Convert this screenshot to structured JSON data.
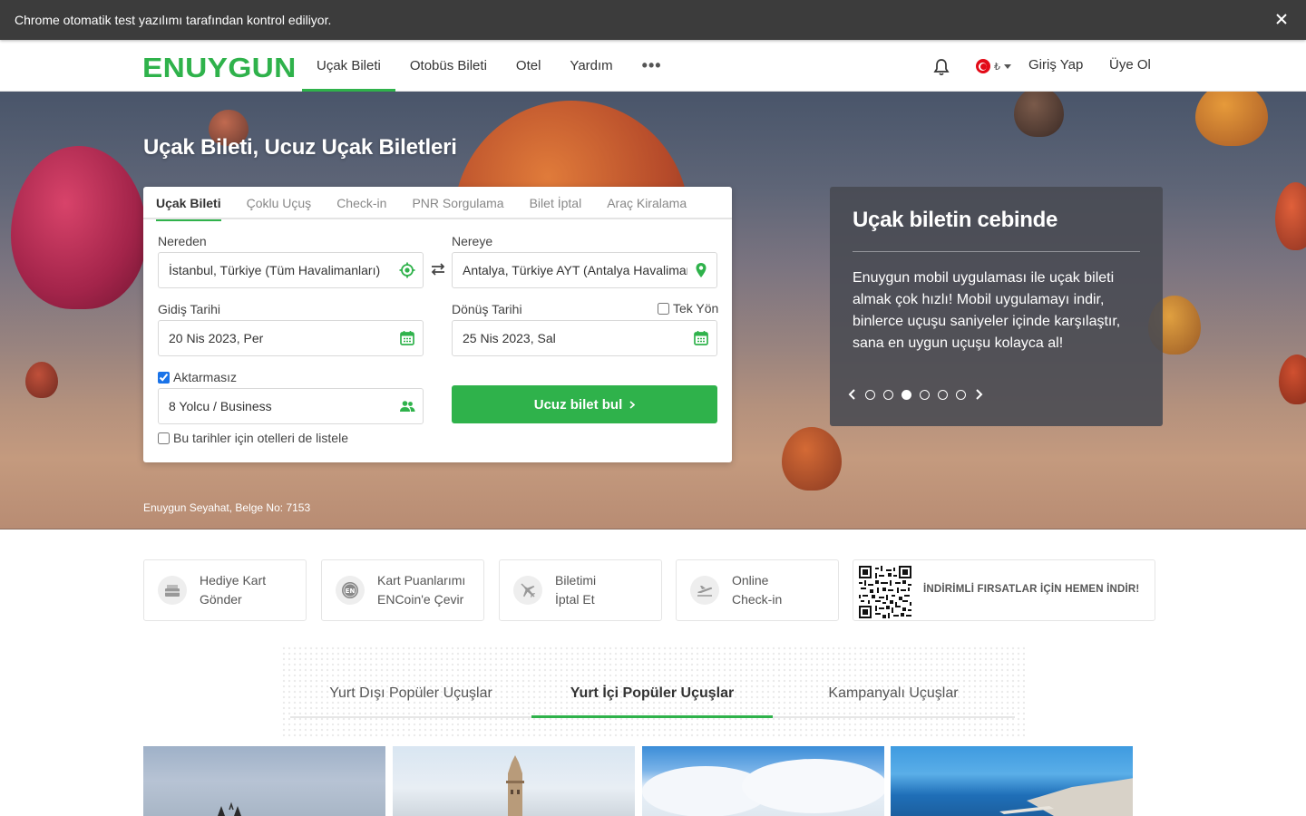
{
  "infobar": {
    "text": "Chrome otomatik test yazılımı tarafından kontrol ediliyor."
  },
  "header": {
    "logo": "ENUYGUN",
    "nav": [
      "Uçak Bileti",
      "Otobüs Bileti",
      "Otel",
      "Yardım"
    ],
    "more": "•••",
    "currency": "₺",
    "login": "Giriş Yap",
    "register": "Üye Ol"
  },
  "hero": {
    "title": "Uçak Bileti, Ucuz Uçak Biletleri",
    "belge": "Enuygun Seyahat, Belge No: 7153"
  },
  "search": {
    "tabs": [
      "Uçak Bileti",
      "Çoklu Uçuş",
      "Check-in",
      "PNR Sorgulama",
      "Bilet İptal",
      "Araç Kiralama"
    ],
    "from_label": "Nereden",
    "from_value": "İstanbul, Türkiye (Tüm Havalimanları)",
    "to_label": "Nereye",
    "to_value": "Antalya, Türkiye AYT (Antalya Havalimanı)",
    "depart_label": "Gidiş Tarihi",
    "depart_value": "20 Nis 2023, Per",
    "return_label": "Dönüş Tarihi",
    "return_value": "25 Nis 2023, Sal",
    "oneway_label": "Tek Yön",
    "direct_label": "Aktarmasız",
    "passengers_value": "8 Yolcu / Business",
    "hotels_label": "Bu tarihler için otelleri de listele",
    "submit": "Ucuz bilet bul"
  },
  "promo": {
    "title": "Uçak biletin cebinde",
    "body": "Enuygun mobil uygulaması ile uçak bileti almak çok hızlı! Mobil uygulamayı indir, binlerce uçuşu saniyeler içinde karşılaştır, sana en uygun uçuşu kolayca al!",
    "active_slide": 3,
    "slide_count": 6
  },
  "quick_actions": [
    {
      "line1": "Hediye Kart",
      "line2": "Gönder",
      "icon": "gift-card-icon"
    },
    {
      "line1": "Kart Puanlarımı",
      "line2": "ENCoin'e Çevir",
      "icon": "encoin-icon"
    },
    {
      "line1": "Biletimi",
      "line2": "İptal Et",
      "icon": "cancel-flight-icon"
    },
    {
      "line1": "Online",
      "line2": "Check-in",
      "icon": "checkin-plane-icon"
    }
  ],
  "app_promo": {
    "text": "İNDİRİMLİ FIRSATLAR İÇİN HEMEN İNDİR!"
  },
  "popular": {
    "tabs": [
      "Yurt Dışı Popüler Uçuşlar",
      "Yurt İçi Popüler Uçuşlar",
      "Kampanyalı Uçuşlar"
    ],
    "active_tab": 1
  },
  "colors": {
    "brand": "#2fb24b",
    "infobar": "#3c3c3c"
  }
}
